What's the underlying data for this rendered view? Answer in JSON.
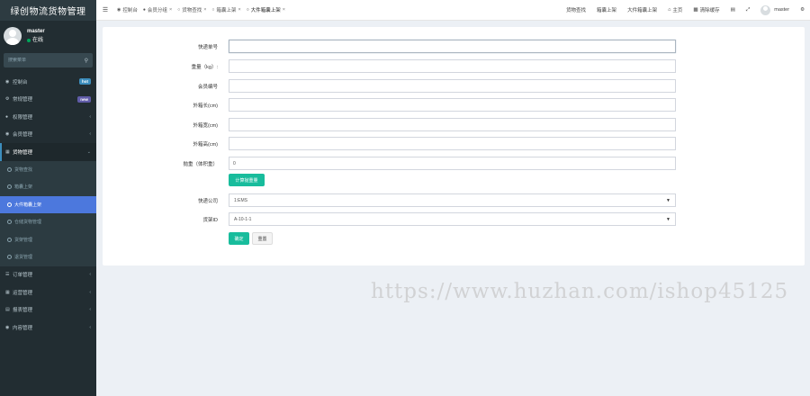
{
  "app": {
    "title": "绿创物流货物管理"
  },
  "user": {
    "name": "master",
    "status": "在线"
  },
  "sidebar": {
    "search_placeholder": "搜索菜单",
    "items": [
      {
        "label": "控制台",
        "badge": "hot",
        "icon": "dashboard-icon"
      },
      {
        "label": "常规管理",
        "badge": "new",
        "icon": "cogs-icon"
      },
      {
        "label": "权限管理",
        "icon": "group-icon"
      },
      {
        "label": "会员管理",
        "icon": "user-circle-icon"
      },
      {
        "label": "货物管理",
        "icon": "truck-icon"
      }
    ],
    "submenu": [
      {
        "label": "货物查找"
      },
      {
        "label": "箱囊上架"
      },
      {
        "label": "大件箱囊上架",
        "active": true
      },
      {
        "label": "仓储货物管理"
      },
      {
        "label": "货架管理"
      },
      {
        "label": "退货管理"
      }
    ],
    "items_after": [
      {
        "label": "订单管理",
        "icon": "list-icon"
      },
      {
        "label": "运营管理",
        "icon": "table-icon"
      },
      {
        "label": "报表管理",
        "icon": "chart-icon"
      },
      {
        "label": "内容管理",
        "icon": "file-icon"
      }
    ]
  },
  "header": {
    "tabs": [
      {
        "label": "控制台",
        "icon": "dashboard-icon",
        "closable": false
      },
      {
        "label": "会员分组",
        "icon": "users-icon",
        "closable": true
      },
      {
        "label": "货物查找",
        "icon": "circle-icon",
        "closable": true
      },
      {
        "label": "箱囊上架",
        "icon": "circle-icon",
        "closable": true
      },
      {
        "label": "大件箱囊上架",
        "icon": "circle-icon",
        "closable": true,
        "active": true
      }
    ],
    "nav": [
      {
        "label": "货物查找"
      },
      {
        "label": "箱囊上架"
      },
      {
        "label": "大件箱囊上架"
      },
      {
        "label": "主页",
        "icon": "home-icon"
      },
      {
        "label": "清除缓存",
        "icon": "trash-icon"
      }
    ],
    "user": "master"
  },
  "form": {
    "fields": [
      {
        "label": "快递单号",
        "value": ""
      },
      {
        "label": "重量（kg）:",
        "value": ""
      },
      {
        "label": "会员编号",
        "value": ""
      },
      {
        "label": "外箱长(cm)",
        "value": ""
      },
      {
        "label": "外箱宽(cm)",
        "value": ""
      },
      {
        "label": "外箱高(cm)",
        "value": ""
      },
      {
        "label": "抛重（体积重）",
        "value": "0"
      }
    ],
    "calc_button": "计算抛重量",
    "selects": [
      {
        "label": "快递公司",
        "value": "1:EMS"
      },
      {
        "label": "货架ID",
        "value": "A-10-1-1"
      }
    ],
    "submit": "确定",
    "reset": "重置"
  },
  "watermark": "https://www.huzhan.com/ishop45125"
}
